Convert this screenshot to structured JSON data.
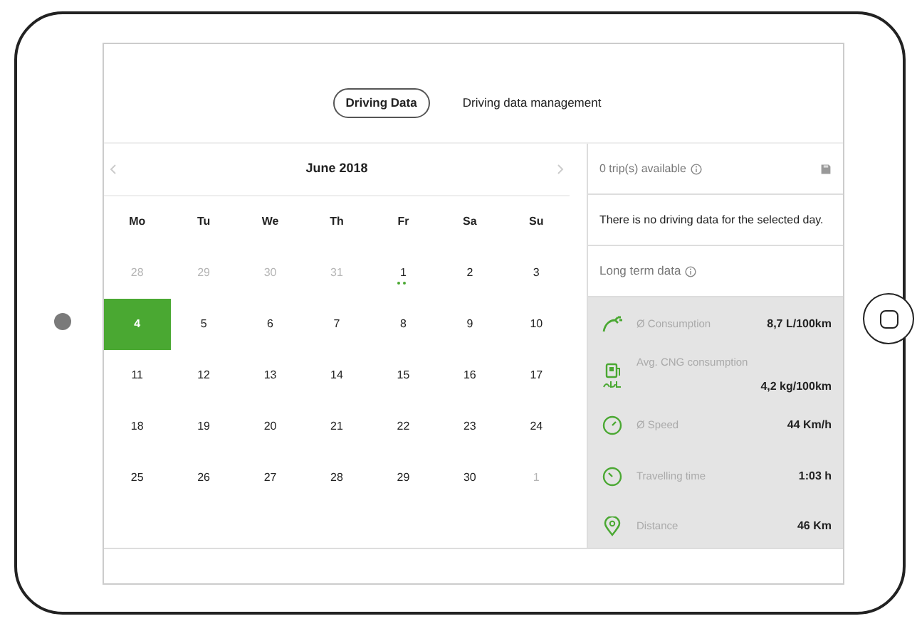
{
  "tabs": [
    {
      "label": "Driving Data",
      "selected": true
    },
    {
      "label": "Driving data management",
      "selected": false
    }
  ],
  "calendar": {
    "title": "June 2018",
    "weekdays": [
      "Mo",
      "Tu",
      "We",
      "Th",
      "Fr",
      "Sa",
      "Su"
    ],
    "weeks": [
      [
        {
          "label": "28",
          "muted": true,
          "selected": false,
          "marked": false
        },
        {
          "label": "29",
          "muted": true,
          "selected": false,
          "marked": false
        },
        {
          "label": "30",
          "muted": true,
          "selected": false,
          "marked": false
        },
        {
          "label": "31",
          "muted": true,
          "selected": false,
          "marked": false
        },
        {
          "label": "1",
          "muted": false,
          "selected": false,
          "marked": true
        },
        {
          "label": "2",
          "muted": false,
          "selected": false,
          "marked": false
        },
        {
          "label": "3",
          "muted": false,
          "selected": false,
          "marked": false
        }
      ],
      [
        {
          "label": "4",
          "muted": false,
          "selected": true,
          "marked": false
        },
        {
          "label": "5",
          "muted": false,
          "selected": false,
          "marked": false
        },
        {
          "label": "6",
          "muted": false,
          "selected": false,
          "marked": false
        },
        {
          "label": "7",
          "muted": false,
          "selected": false,
          "marked": false
        },
        {
          "label": "8",
          "muted": false,
          "selected": false,
          "marked": false
        },
        {
          "label": "9",
          "muted": false,
          "selected": false,
          "marked": false
        },
        {
          "label": "10",
          "muted": false,
          "selected": false,
          "marked": false
        }
      ],
      [
        {
          "label": "11",
          "muted": false,
          "selected": false,
          "marked": false
        },
        {
          "label": "12",
          "muted": false,
          "selected": false,
          "marked": false
        },
        {
          "label": "13",
          "muted": false,
          "selected": false,
          "marked": false
        },
        {
          "label": "14",
          "muted": false,
          "selected": false,
          "marked": false
        },
        {
          "label": "15",
          "muted": false,
          "selected": false,
          "marked": false
        },
        {
          "label": "16",
          "muted": false,
          "selected": false,
          "marked": false
        },
        {
          "label": "17",
          "muted": false,
          "selected": false,
          "marked": false
        }
      ],
      [
        {
          "label": "18",
          "muted": false,
          "selected": false,
          "marked": false
        },
        {
          "label": "19",
          "muted": false,
          "selected": false,
          "marked": false
        },
        {
          "label": "20",
          "muted": false,
          "selected": false,
          "marked": false
        },
        {
          "label": "21",
          "muted": false,
          "selected": false,
          "marked": false
        },
        {
          "label": "22",
          "muted": false,
          "selected": false,
          "marked": false
        },
        {
          "label": "23",
          "muted": false,
          "selected": false,
          "marked": false
        },
        {
          "label": "24",
          "muted": false,
          "selected": false,
          "marked": false
        }
      ],
      [
        {
          "label": "25",
          "muted": false,
          "selected": false,
          "marked": false
        },
        {
          "label": "26",
          "muted": false,
          "selected": false,
          "marked": false
        },
        {
          "label": "27",
          "muted": false,
          "selected": false,
          "marked": false
        },
        {
          "label": "28",
          "muted": false,
          "selected": false,
          "marked": false
        },
        {
          "label": "29",
          "muted": false,
          "selected": false,
          "marked": false
        },
        {
          "label": "30",
          "muted": false,
          "selected": false,
          "marked": false
        },
        {
          "label": "1",
          "muted": true,
          "selected": false,
          "marked": false
        }
      ]
    ]
  },
  "trips": {
    "title": "0 trip(s) available",
    "message": "There is no driving data for the selected day."
  },
  "long_term": {
    "title": "Long term data",
    "items": [
      {
        "kind": "consumption",
        "label": "Ø Consumption",
        "value": "8,7 L/100km"
      },
      {
        "kind": "cng",
        "label": "Avg. CNG consumption",
        "value": "4,2 kg/100km"
      },
      {
        "kind": "speed",
        "label": "Ø Speed",
        "value": "44 Km/h"
      },
      {
        "kind": "time",
        "label": "Travelling time",
        "value": "1:03 h"
      },
      {
        "kind": "distance",
        "label": "Distance",
        "value": "46 Km"
      }
    ]
  }
}
